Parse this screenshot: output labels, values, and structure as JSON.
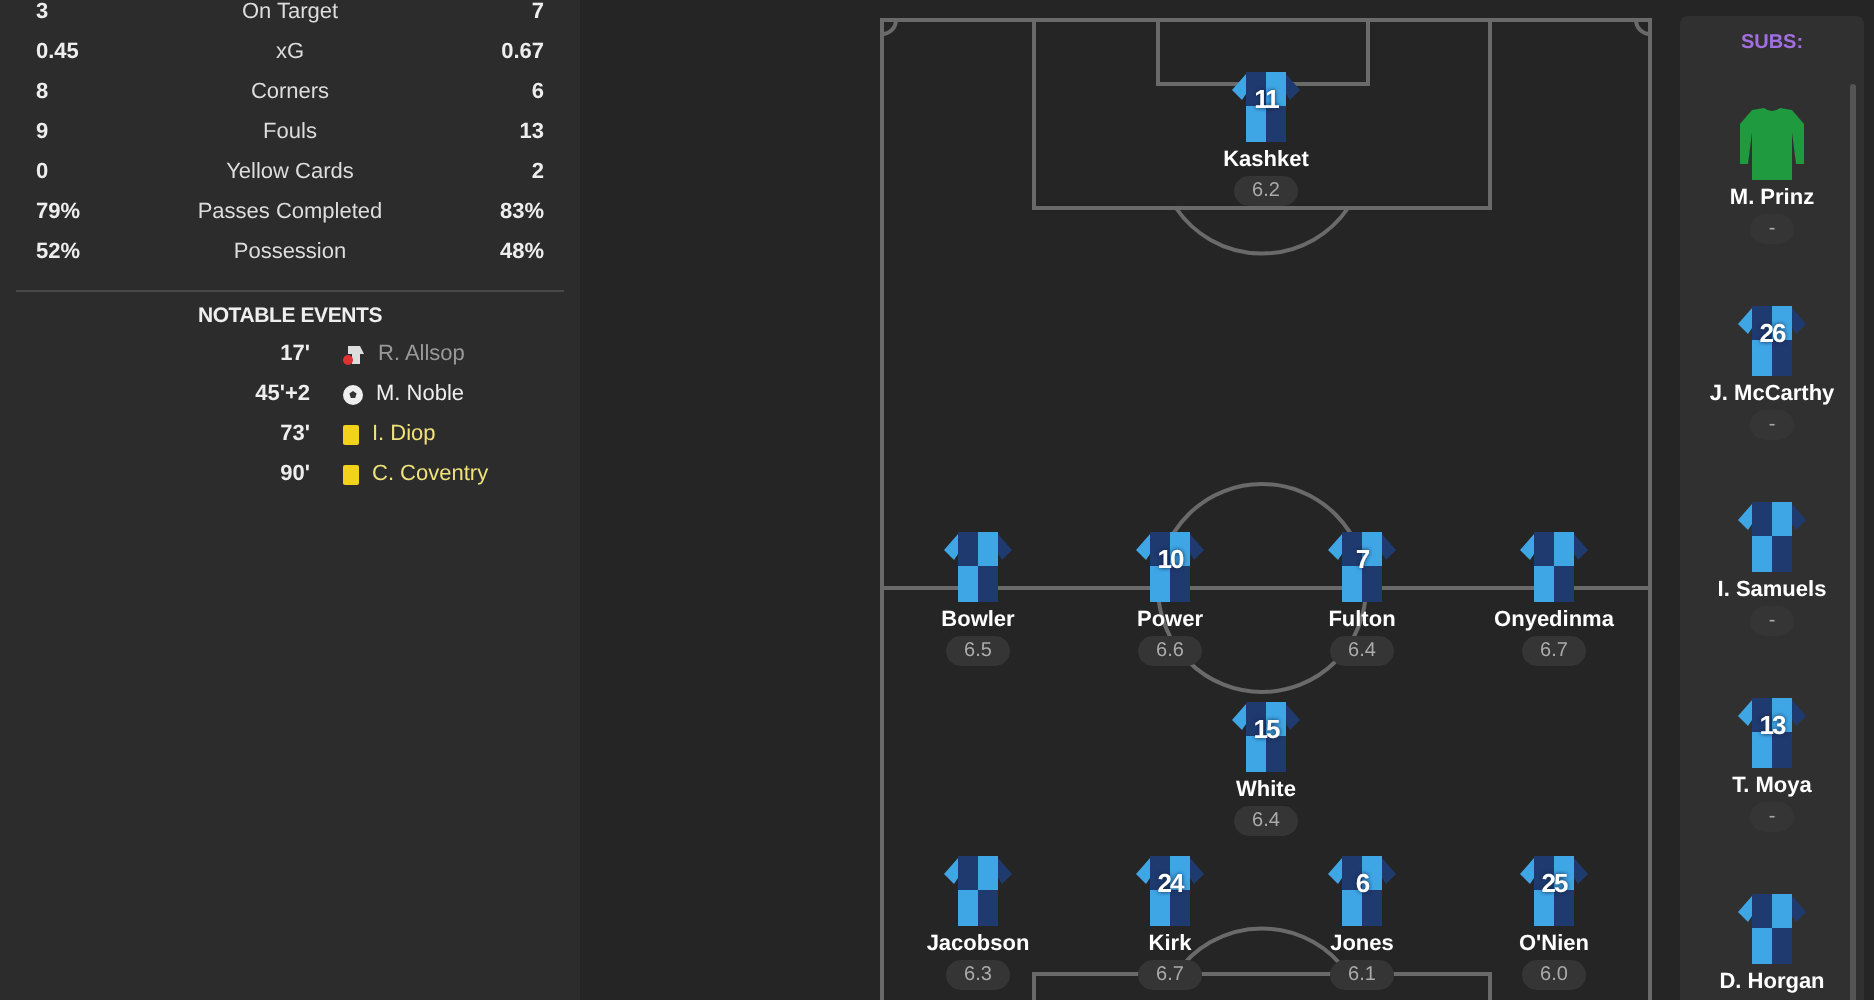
{
  "stats": [
    {
      "home": "3",
      "label": "On Target",
      "away": "7"
    },
    {
      "home": "0.45",
      "label": "xG",
      "away": "0.67"
    },
    {
      "home": "8",
      "label": "Corners",
      "away": "6"
    },
    {
      "home": "9",
      "label": "Fouls",
      "away": "13"
    },
    {
      "home": "0",
      "label": "Yellow Cards",
      "away": "2"
    },
    {
      "home": "79%",
      "label": "Passes Completed",
      "away": "83%"
    },
    {
      "home": "52%",
      "label": "Possession",
      "away": "48%"
    }
  ],
  "notable_events": {
    "title": "NOTABLE EVENTS",
    "events": [
      {
        "minute": "17'",
        "kind": "substitution",
        "player": "R. Allsop"
      },
      {
        "minute": "45'+2",
        "kind": "goal",
        "player": "M. Noble"
      },
      {
        "minute": "73'",
        "kind": "yellow_card",
        "player": "I. Diop"
      },
      {
        "minute": "90'",
        "kind": "yellow_card",
        "player": "C. Coventry"
      }
    ]
  },
  "pitch": {
    "rows": [
      {
        "players": [
          {
            "name": "Kashket",
            "number": "11",
            "kind": "outfield",
            "rating": "6.2"
          }
        ]
      },
      {
        "players": [
          {
            "name": "Bowler",
            "kind": "outfield",
            "rating": "6.5"
          },
          {
            "name": "Power",
            "number": "10",
            "kind": "outfield",
            "rating": "6.6"
          },
          {
            "name": "Fulton",
            "number": "7",
            "kind": "outfield",
            "rating": "6.4"
          },
          {
            "name": "Onyedinma",
            "kind": "outfield",
            "rating": "6.7"
          }
        ]
      },
      {
        "players": [
          {
            "name": "White",
            "number": "15",
            "kind": "outfield",
            "rating": "6.4"
          }
        ]
      },
      {
        "players": [
          {
            "name": "Jacobson",
            "kind": "outfield",
            "rating": "6.3"
          },
          {
            "name": "Kirk",
            "number": "24",
            "kind": "outfield",
            "rating": "6.7"
          },
          {
            "name": "Jones",
            "number": "6",
            "kind": "outfield",
            "rating": "6.1"
          },
          {
            "name": "O'Nien",
            "number": "25",
            "kind": "outfield",
            "rating": "6.0"
          }
        ]
      }
    ]
  },
  "subs": {
    "title": "SUBS:",
    "players": [
      {
        "name": "M. Prinz",
        "kind": "keeper",
        "rating": "-"
      },
      {
        "name": "J. McCarthy",
        "number": "26",
        "kind": "outfield",
        "rating": "-"
      },
      {
        "name": "I. Samuels",
        "kind": "outfield",
        "rating": "-"
      },
      {
        "name": "T. Moya",
        "number": "13",
        "kind": "outfield",
        "rating": "-"
      },
      {
        "name": "D. Horgan",
        "kind": "outfield"
      }
    ]
  }
}
